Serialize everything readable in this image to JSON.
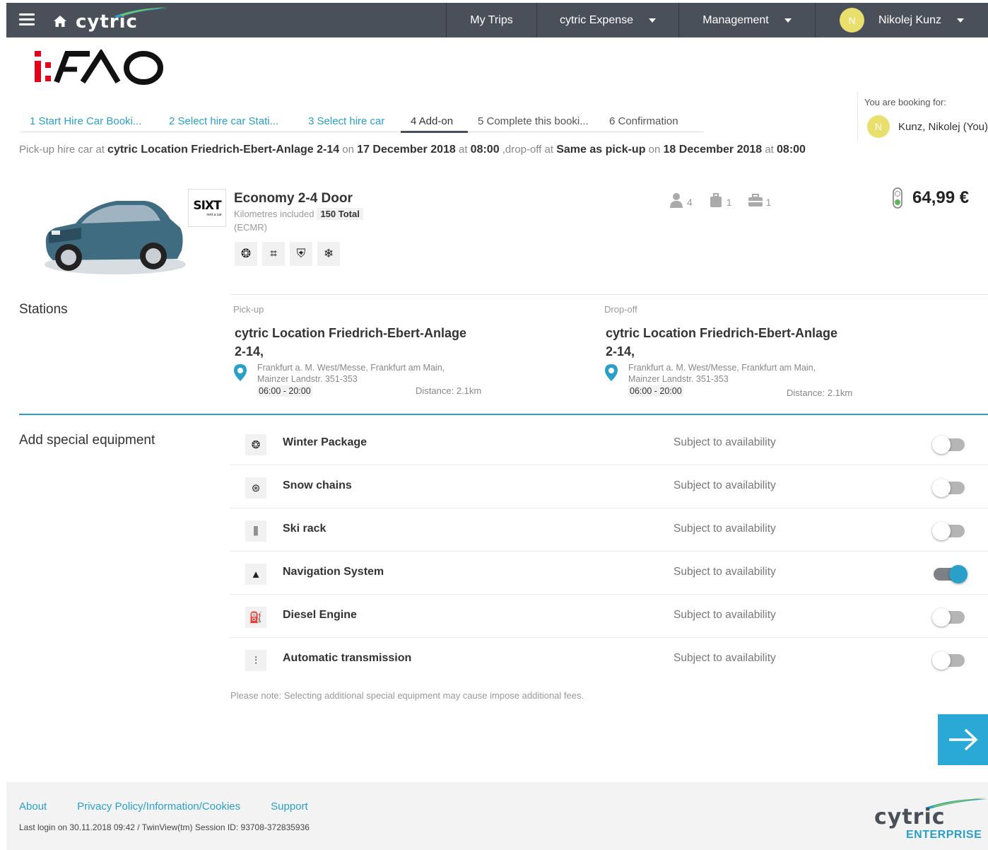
{
  "colors": {
    "accent": "#2aa0c8",
    "topbar": "#4a5059",
    "avatar": "#e8df6d",
    "price_light": "#5cb85c"
  },
  "header": {
    "brand": "cytric",
    "nav": [
      {
        "label": "My Trips"
      },
      {
        "label": "cytric Expense"
      },
      {
        "label": "Management"
      }
    ],
    "user": {
      "initial": "N",
      "name": "Nikolej Kunz"
    }
  },
  "logo": "i:FAO",
  "booking_for": {
    "label": "You are booking for:",
    "initial": "N",
    "name": "Kunz, Nikolej (You)"
  },
  "steps": [
    {
      "label": "1  Start Hire Car Booki...",
      "state": "done"
    },
    {
      "label": "2  Select hire car Stati...",
      "state": "done"
    },
    {
      "label": "3  Select hire car",
      "state": "done"
    },
    {
      "label": "4  Add-on",
      "state": "active"
    },
    {
      "label": "5  Complete this booki...",
      "state": "future"
    },
    {
      "label": "6  Confirmation",
      "state": "future"
    }
  ],
  "summary": {
    "t1": "Pick-up hire car at ",
    "location": "cytric Location Friedrich-Ebert-Anlage 2-14",
    "t2": " on ",
    "pickup_date": "17 December 2018",
    "t3": " at ",
    "pickup_time": "08:00",
    "t4": " ,drop-off at ",
    "dropoff": "Same as pick-up",
    "t5": " on ",
    "dropoff_date": "18 December 2018",
    "t6": " at ",
    "dropoff_time": "08:00"
  },
  "car": {
    "vendor": "SIXT",
    "vendor_sub": "rent a car",
    "name": "Economy 2-4 Door",
    "km_label": "Kilometres included",
    "km_value": "150 Total",
    "code": "(ECMR)",
    "features": [
      "winter-tire-icon",
      "gearshift-icon",
      "shield-icon",
      "air-conditioning-icon"
    ],
    "feature_glyphs": [
      "❂",
      "⌗",
      "⛨",
      "❄"
    ],
    "passengers": "4",
    "large_bags": "1",
    "small_bags": "1",
    "price": "64,99 €"
  },
  "stations": {
    "title": "Stations",
    "pickup": {
      "label": "Pick-up",
      "name": "cytric Location Friedrich-Ebert-Anlage 2-14,",
      "addr1": "Frankfurt a. M. West/Messe, Frankfurt am Main,",
      "addr2": "Mainzer Landstr. 351-353",
      "hours": "06:00 - 20:00",
      "distance": "Distance: 2.1km"
    },
    "dropoff": {
      "label": "Drop-off",
      "name": "cytric Location Friedrich-Ebert-Anlage 2-14,",
      "addr1": "Frankfurt a. M. West/Messe, Frankfurt am Main,",
      "addr2": "Mainzer Landstr. 351-353",
      "hours": "06:00 - 20:00",
      "distance": "Distance: 2.1km"
    }
  },
  "equipment": {
    "title": "Add special equipment",
    "items": [
      {
        "name": "Winter Package",
        "availability": "Subject to availability",
        "icon": "winter-package-icon",
        "glyph": "❂",
        "on": false
      },
      {
        "name": "Snow chains",
        "availability": "Subject to availability",
        "icon": "snow-chains-icon",
        "glyph": "⊛",
        "on": false
      },
      {
        "name": "Ski rack",
        "availability": "Subject to availability",
        "icon": "ski-rack-icon",
        "glyph": "⫼",
        "on": false
      },
      {
        "name": "Navigation System",
        "availability": "Subject to availability",
        "icon": "navigation-icon",
        "glyph": "▲",
        "on": true
      },
      {
        "name": "Diesel Engine",
        "availability": "Subject to availability",
        "icon": "fuel-pump-icon",
        "glyph": "⛽",
        "on": false
      },
      {
        "name": "Automatic transmission",
        "availability": "Subject to availability",
        "icon": "automatic-gear-icon",
        "glyph": "⫶",
        "on": false
      }
    ],
    "note": "Please note: Selecting additional special equipment may cause impose additional fees."
  },
  "footer": {
    "links": [
      "About",
      "Privacy Policy/Information/Cookies",
      "Support"
    ],
    "meta": "Last login on 30.11.2018 09:42  /  TwinView(tm) Session ID: 93708-372835936",
    "brand": "cytric",
    "edition": "ENTERPRISE"
  }
}
